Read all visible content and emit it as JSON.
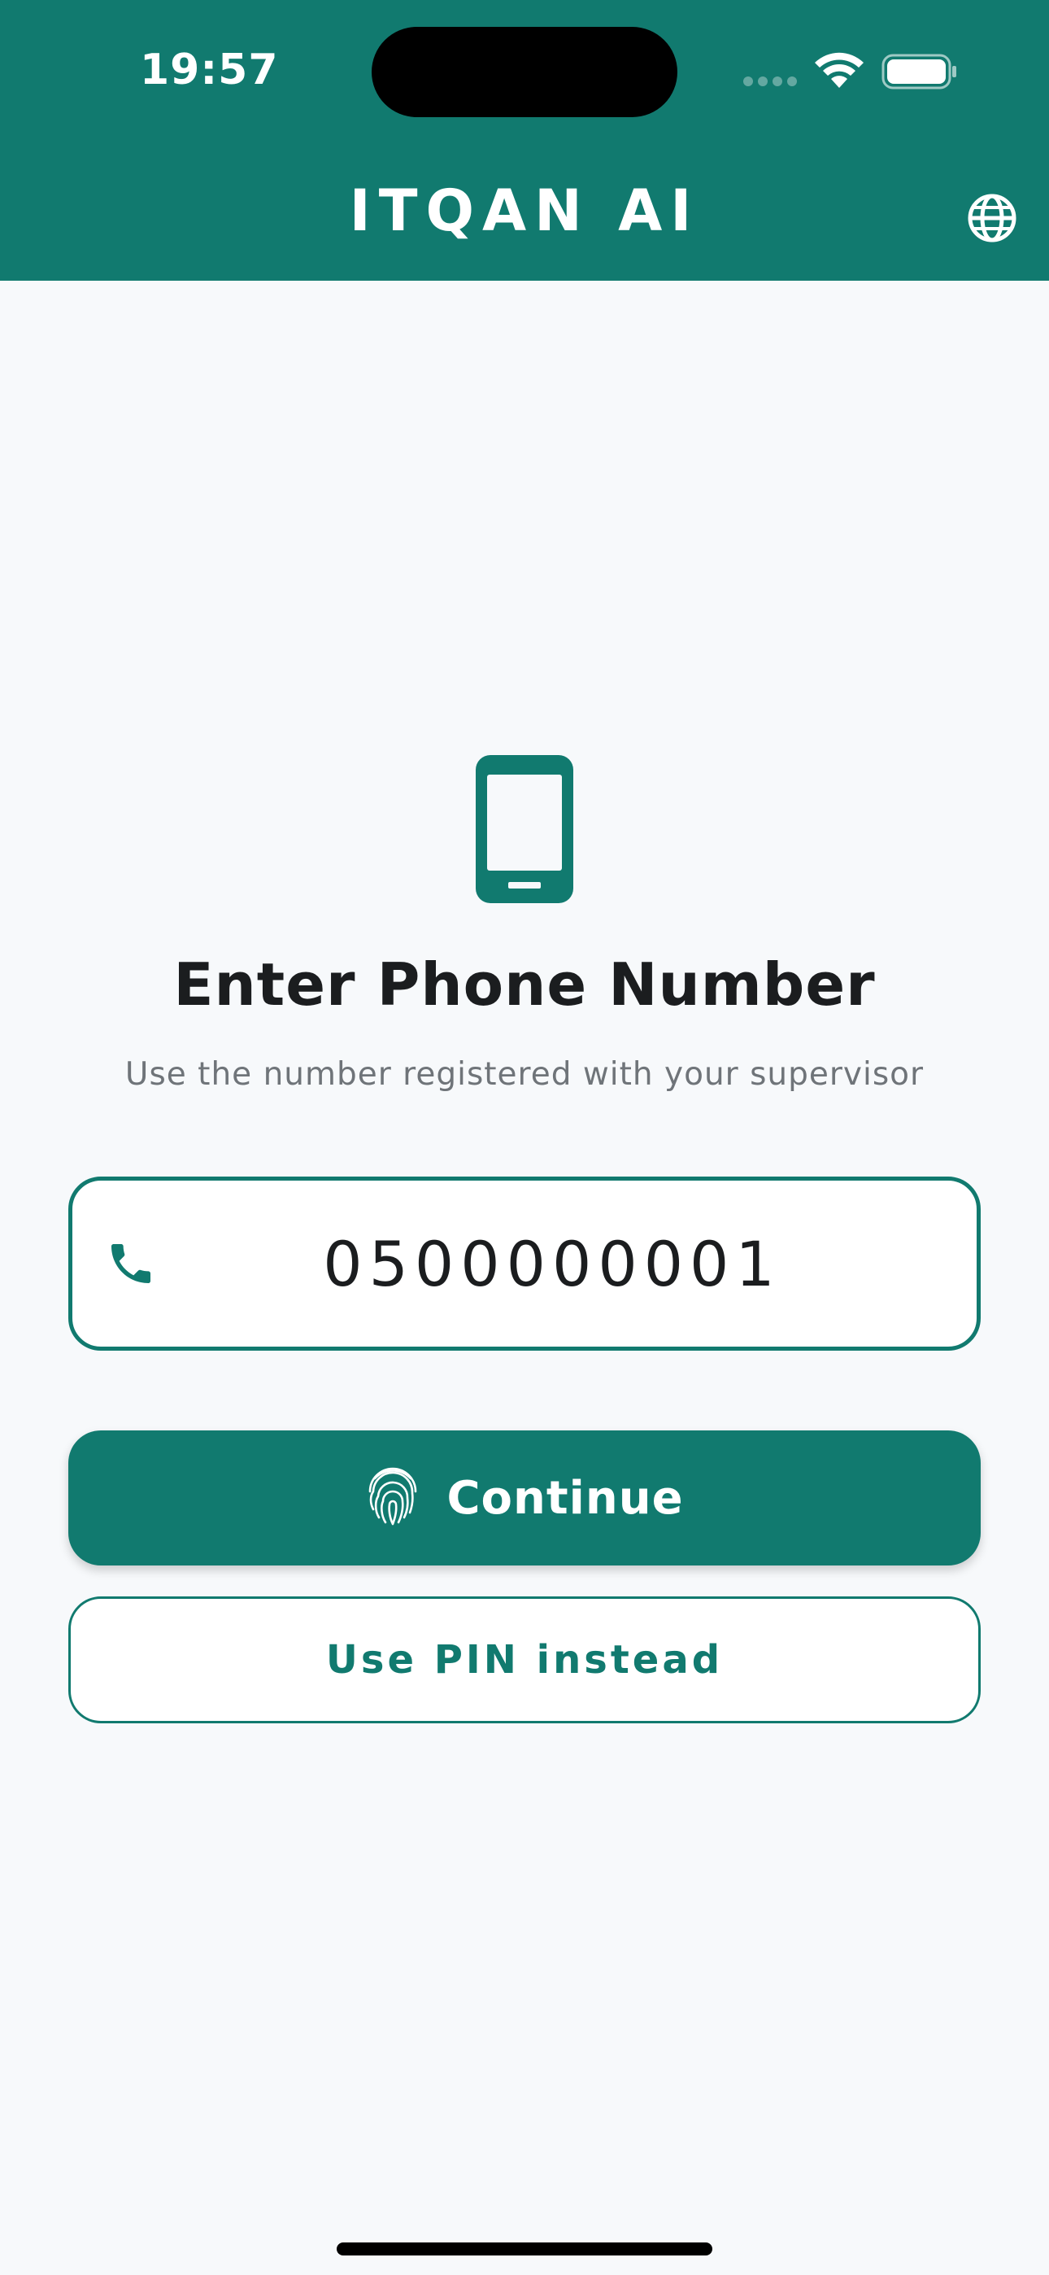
{
  "status_bar": {
    "time": "19:57"
  },
  "header": {
    "title": "ITQAN AI",
    "language_icon": "globe-icon"
  },
  "login": {
    "icon": "smartphone-icon",
    "heading": "Enter Phone Number",
    "subtext": "Use the number registered with your supervisor",
    "phone_field": {
      "icon": "phone-icon",
      "value": "0500000001"
    },
    "continue_button": {
      "icon": "fingerprint-icon",
      "label": "Continue"
    },
    "pin_button": {
      "label": "Use PIN instead"
    }
  },
  "colors": {
    "primary": "#117a6f",
    "background": "#f7f9fb",
    "text": "#1b1d1f",
    "muted_text": "#6f7479"
  }
}
